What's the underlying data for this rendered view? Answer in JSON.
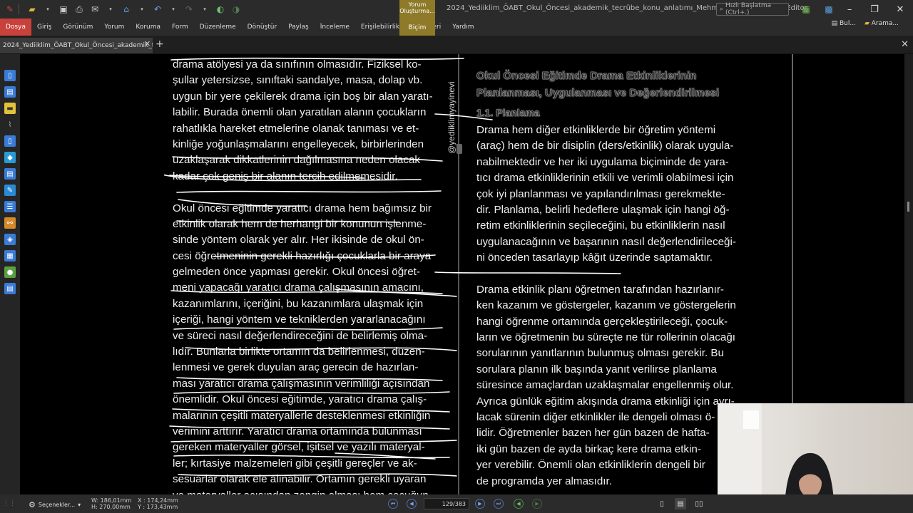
{
  "app": {
    "window_title": "2024_Yediiklim_ÖABT_Okul_Öncesi_akademik_tecrübe_konu_anlatımı_Mehmet* - PDF-XChange Editor",
    "search_placeholder": "Hızlı Başlatma (Ctrl+.)"
  },
  "ribbon": {
    "tabs": [
      "Dosya",
      "Giriş",
      "Görünüm",
      "Yorum",
      "Koruma",
      "Form",
      "Düzenleme",
      "Dönüştür",
      "Paylaş",
      "İnceleme",
      "Erişilebilirlik",
      "Yer İmleri",
      "Yardım"
    ],
    "context_group": "Yorum Oluşturma...",
    "context_tab": "Biçim",
    "right_items": [
      "Bul...",
      "Arama..."
    ]
  },
  "doc_tab": {
    "label": "2024_Yediiklim_ÖABT_Okul_Öncesi_akademik_tecrü...*"
  },
  "page": {
    "side_watermark": "@yediiklimyayinevi",
    "left_column": [
      "drama atölyesi ya da sınıfının olmasıdır. Fiziksel ko-",
      "şullar yetersizse, sınıftaki sandalye, masa, dolap vb.",
      "uygun bir yere çekilerek drama için boş bir alan yaratı-",
      "labilir. Burada önemli olan yaratılan alanın çocukların",
      "rahatlıkla hareket etmelerine olanak tanıması ve et-",
      "kinliğe yoğunlaşmalarını engelleyecek, birbirlerinden",
      "uzaklaşarak dikkatlerinin dağılmasına neden olacak",
      "kadar çok geniş bir alanın tercih edilmemesidir.",
      "",
      "Okul öncesi eğitimde yaratıcı drama hem bağımsız bir",
      "etkinlik olarak hem de herhangi bir konunun işlenme-",
      "sinde yöntem olarak yer alır. Her ikisinde de okul ön-",
      "cesi öğretmeninin gerekli hazırlığı çocuklarla bir araya",
      "gelmeden önce yapması gerekir. Okul öncesi öğret-",
      "meni yapacağı yaratıcı drama çalışmasının amacını,",
      "kazanımlarını, içeriğini, bu kazanımlara ulaşmak için",
      "içeriği, hangi yöntem ve tekniklerden yararlanacağını",
      "ve süreci nasıl değerlendireceğini de belirlemiş olma-",
      "lıdır. Bunlarla birlikte ortamın da belirlenmesi, düzen-",
      "lenmesi ve gerek duyulan araç gerecin de hazırlan-",
      "ması yaratıcı drama çalışmasının verimliliği açısından",
      "önemlidir. Okul öncesi eğitimde, yaratıcı drama çalış-",
      "malarının çeşitli materyallerle desteklenmesi etkinliğin",
      "verimini arttırır. Yaratıcı drama ortamında bulunması",
      "gereken materyaller görsel, işitsel ve yazılı materyal-",
      "ler; kırtasiye malzemeleri gibi çeşitli gereçler ve ak-",
      "sesuarlar olarak ele alınabilir. Ortamın gerekli uyaran",
      "ve materyaller açısından zengin olması hem çocuğun"
    ],
    "heading_title_1": "Okul Öncesi Eğitimde Drama Etkinliklerinin",
    "heading_title_2": "Planlanması, Uygulanması ve Değerlendirilmesi",
    "heading_sub": "1.1. Planlama",
    "right_column": [
      "Drama hem diğer etkinliklerde bir öğretim yöntemi",
      "(araç) hem de bir disiplin (ders/etkinlik) olarak uygula-",
      "nabilmektedir ve her iki uygulama biçiminde de yara-",
      "tıcı drama etkinliklerinin etkili ve verimli olabilmesi için",
      "çok iyi planlanması ve yapılandırılması gerekmekte-",
      "dir. Planlama, belirli hedeflere ulaşmak için hangi öğ-",
      "retim etkinliklerinin seçileceğini, bu etkinliklerin nasıl",
      "uygulanacağının ve başarının nasıl değerlendirileceği-",
      "ni önceden tasarlayıp kâğıt üzerinde saptamaktır.",
      "",
      "Drama etkinlik planı öğretmen tarafından hazırlanır-",
      "ken kazanım ve göstergeler, kazanım ve göstergelerin",
      "hangi öğrenme ortamında gerçekleştirileceği, çocuk-",
      "ların ve öğretmenin bu süreçte ne tür rollerinin olacağı",
      "sorularının yanıtlarının bulunmuş olması gerekir. Bu",
      "sorulara planın ilk başında yanıt verilirse planlama",
      "süresince amaçlardan uzaklaşmalar engellenmiş olur.",
      "Ayrıca günlük eğitim akışında drama etkinliği için ayrı-",
      "lacak sürenin diğer etkinlikler ile dengeli olması ö-",
      "lidir. Öğretmenler bazen her gün bazen de hafta-",
      "iki gün bazen de ayda birkaç kere drama etkin-",
      "yer verebilir. Önemli olan etkinliklerin dengeli bir",
      "de programda yer almasıdır."
    ]
  },
  "statusbar": {
    "options_label": "Seçenekler...",
    "width": "W: 186,01mm",
    "height": "H: 270,00mm",
    "x_coord": "X : 174,24mm",
    "y_coord": "Y : 173,43mm",
    "page_indicator": "129/383"
  }
}
